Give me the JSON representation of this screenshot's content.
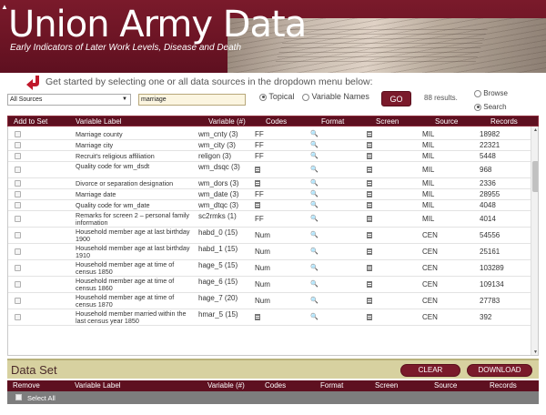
{
  "header": {
    "title": "Union Army Data",
    "subtitle": "Early Indicators of Later Work Levels, Disease and Death"
  },
  "prompt": "Get started by selecting one or all data sources in the dropdown menu below:",
  "controls": {
    "source_select": "All Sources",
    "search_value": "marriage",
    "topical_label": "Topical",
    "variable_names_label": "Variable Names",
    "go_label": "GO",
    "results_text": "88 results.",
    "browse_label": "Browse",
    "search_label": "Search"
  },
  "columns": [
    "Add to Set",
    "Variable Label",
    "Variable (#)",
    "Codes",
    "Format",
    "Screen",
    "Source",
    "Records"
  ],
  "rows": [
    {
      "label": "Marriage county",
      "var": "wm_cnty (3)",
      "codes": "FF",
      "source": "MIL",
      "records": "18982"
    },
    {
      "label": "Marriage city",
      "var": "wm_city (3)",
      "codes": "FF",
      "source": "MIL",
      "records": "22321"
    },
    {
      "label": "Recruit's religious affiliation",
      "var": "religon (3)",
      "codes": "FF",
      "source": "MIL",
      "records": "5448"
    },
    {
      "label": "Quality code for wm_dsdt",
      "var": "wm_dsqc (3)",
      "codes": "",
      "source": "MIL",
      "records": "968"
    },
    {
      "label": "Divorce or separation designation",
      "var": "wm_dors (3)",
      "codes": "",
      "source": "MIL",
      "records": "2336"
    },
    {
      "label": "Marriage date",
      "var": "wm_date (3)",
      "codes": "FF",
      "source": "MIL",
      "records": "28955"
    },
    {
      "label": "Quality code for wm_date",
      "var": "wm_dtqc (3)",
      "codes": "",
      "source": "MIL",
      "records": "4048"
    },
    {
      "label": "Remarks for screen 2 – personal family information",
      "var": "sc2rmks (1)",
      "codes": "FF",
      "source": "MIL",
      "records": "4014"
    },
    {
      "label": "Household member age at last birthday 1900",
      "var": "habd_0 (15)",
      "codes": "Num",
      "source": "CEN",
      "records": "54556"
    },
    {
      "label": "Household member age at last birthday 1910",
      "var": "habd_1 (15)",
      "codes": "Num",
      "source": "CEN",
      "records": "25161"
    },
    {
      "label": "Household member age at time of census 1850",
      "var": "hage_5 (15)",
      "codes": "Num",
      "source": "CEN",
      "records": "103289"
    },
    {
      "label": "Household member age at time of census 1860",
      "var": "hage_6 (15)",
      "codes": "Num",
      "source": "CEN",
      "records": "109134"
    },
    {
      "label": "Household member age at time of census 1870",
      "var": "hage_7 (20)",
      "codes": "Num",
      "source": "CEN",
      "records": "27783"
    },
    {
      "label": "Household member married within the last census year 1850",
      "var": "hmar_5 (15)",
      "codes": "",
      "source": "CEN",
      "records": "392"
    }
  ],
  "dataset": {
    "title": "Data Set",
    "clear_label": "CLEAR",
    "download_label": "DOWNLOAD",
    "columns": [
      "Remove",
      "Variable Label",
      "Variable (#)",
      "Codes",
      "Format",
      "Screen",
      "Source",
      "Records"
    ],
    "select_all_label": "Select All"
  },
  "colors": {
    "brand": "#7a1a2b",
    "dataset_bar": "#d7d1a0"
  }
}
